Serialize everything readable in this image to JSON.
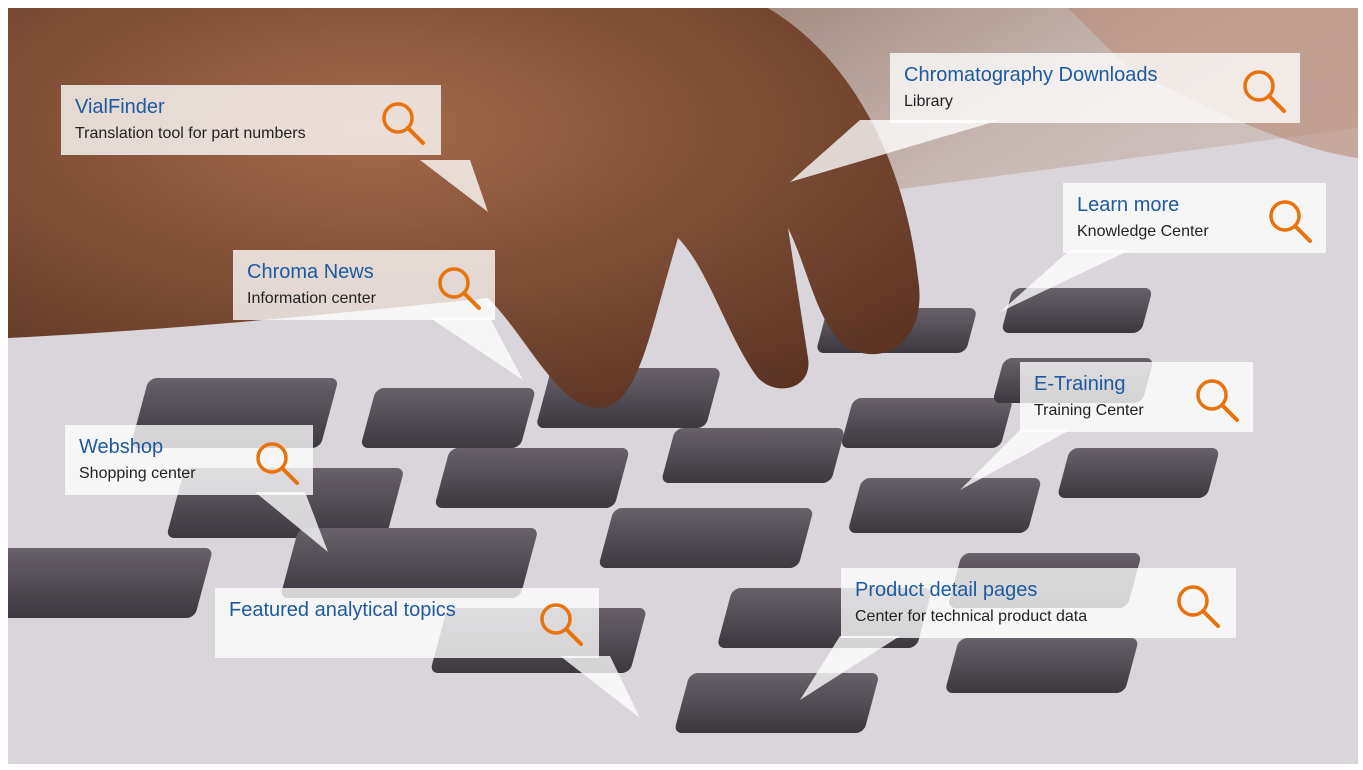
{
  "hotspots": [
    {
      "id": "vialfinder",
      "title": "VialFinder",
      "subtitle": "Translation tool for part numbers",
      "icon": "search-icon"
    },
    {
      "id": "chromatography-downloads",
      "title": "Chromatography Downloads",
      "subtitle": "Library",
      "icon": "search-icon"
    },
    {
      "id": "learn-more",
      "title": "Learn more",
      "subtitle": "Knowledge Center",
      "icon": "search-icon"
    },
    {
      "id": "chroma-news",
      "title": "Chroma News",
      "subtitle": "Information center",
      "icon": "search-icon"
    },
    {
      "id": "e-training",
      "title": "E-Training",
      "subtitle": "Training Center",
      "icon": "search-icon"
    },
    {
      "id": "webshop",
      "title": "Webshop",
      "subtitle": "Shopping center",
      "icon": "search-icon"
    },
    {
      "id": "featured-topics",
      "title": "Featured analytical topics",
      "subtitle": "",
      "icon": "search-icon"
    },
    {
      "id": "product-detail",
      "title": "Product detail pages",
      "subtitle": "Center for technical product data",
      "icon": "search-icon"
    }
  ],
  "colors": {
    "title": "#1e5aa0",
    "icon": "#e8720c",
    "callout_bg": "rgba(255,255,255,0.78)"
  }
}
